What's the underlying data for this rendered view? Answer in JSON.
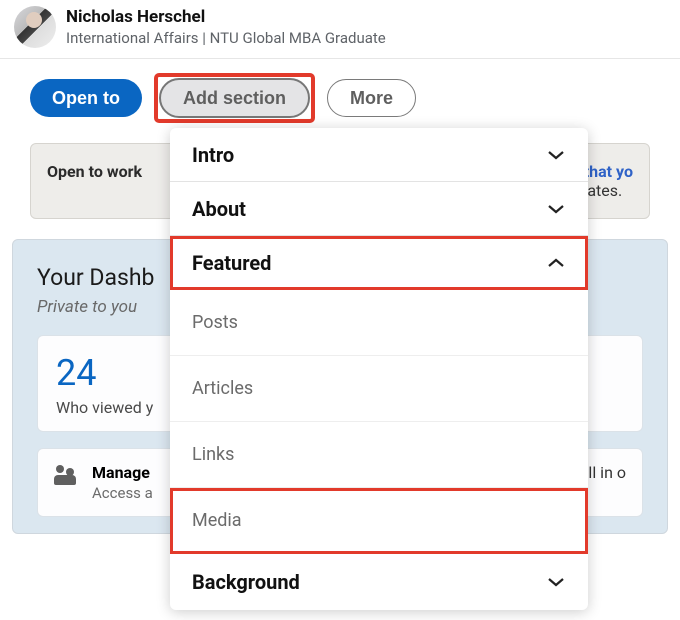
{
  "profile": {
    "name": "Nicholas Herschel",
    "headline": "International Affairs | NTU Global MBA Graduate"
  },
  "buttons": {
    "open_to": "Open to",
    "add_section": "Add section",
    "more": "More"
  },
  "open_panel": {
    "title": "Open to work",
    "right_link_fragment": "re that yo",
    "right_sub_fragment": "didates."
  },
  "dashboard": {
    "title_fragment": "Your Dashb",
    "subtitle_fragment": "Private to you",
    "stat_number": "24",
    "stat_caption_fragment": "Who viewed y",
    "manage_title_fragment": "Manage",
    "manage_sub_fragment": "Access a",
    "manage_trail_fragment": "sts all in o"
  },
  "dropdown": {
    "intro": "Intro",
    "about": "About",
    "featured": "Featured",
    "posts": "Posts",
    "articles": "Articles",
    "links": "Links",
    "media": "Media",
    "background": "Background"
  }
}
